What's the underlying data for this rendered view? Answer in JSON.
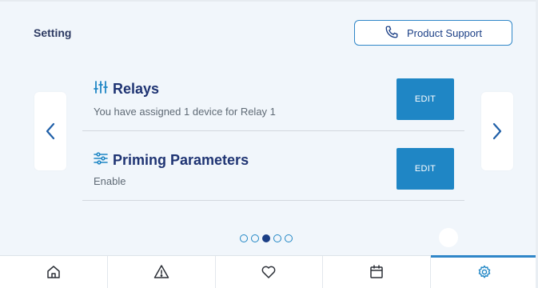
{
  "header": {
    "title": "Setting",
    "support_label": "Product Support"
  },
  "cards": [
    {
      "title": "Relays",
      "description": "You have assigned 1 device for Relay 1",
      "edit_label": "EDIT",
      "icon": "sliders-icon"
    },
    {
      "title": "Priming Parameters",
      "description": "Enable",
      "edit_label": "EDIT",
      "icon": "horizontal-sliders-icon"
    }
  ],
  "pager": {
    "total": 5,
    "active_index": 2
  },
  "navbar": {
    "items": [
      {
        "icon": "home-icon"
      },
      {
        "icon": "warning-icon"
      },
      {
        "icon": "heart-icon"
      },
      {
        "icon": "calendar-icon"
      },
      {
        "icon": "gear-icon",
        "active": true
      }
    ]
  },
  "colors": {
    "accent": "#1f86c5",
    "title": "#1f3473",
    "background": "#f1f6fb"
  }
}
